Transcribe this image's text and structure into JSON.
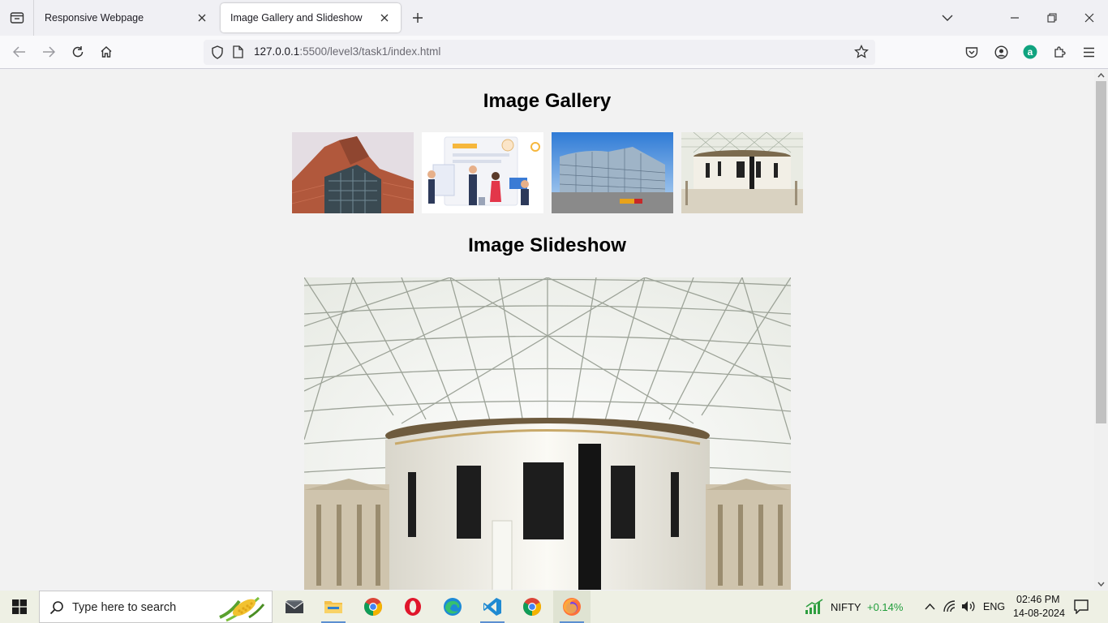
{
  "browser": {
    "tabs": [
      {
        "title": "Responsive Webpage",
        "active": false
      },
      {
        "title": "Image Gallery and Slideshow",
        "active": true
      }
    ],
    "url_host": "127.0.0.1",
    "url_rest": ":5500/level3/task1/index.html"
  },
  "page": {
    "gallery_heading": "Image Gallery",
    "slideshow_heading": "Image Slideshow",
    "gallery_images": [
      "building-facade-photo",
      "team-office-illustration",
      "glass-office-building-photo",
      "museum-courtyard-photo"
    ],
    "slide_image": "museum-glass-roof-photo"
  },
  "taskbar": {
    "search_placeholder": "Type here to search",
    "stock_name": "NIFTY",
    "stock_change": "+0.14%",
    "language": "ENG",
    "time": "02:46 PM",
    "date": "14-08-2024"
  },
  "colors": {
    "accent": "#0060df",
    "stock_up": "#1f9d3a",
    "page_bg": "#f2f2f2"
  }
}
